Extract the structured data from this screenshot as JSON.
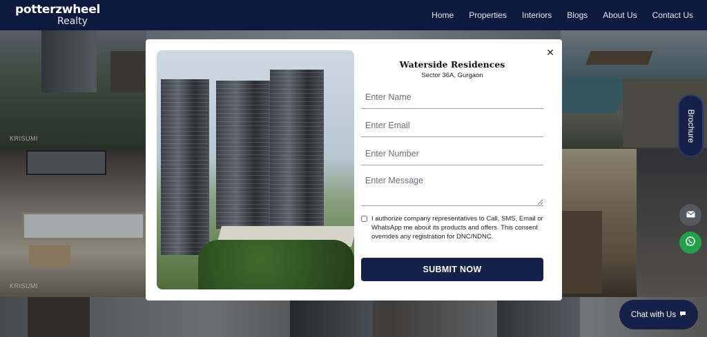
{
  "header": {
    "logo_line1": "potterzwheel",
    "logo_line2": "Realty",
    "nav": [
      "Home",
      "Properties",
      "Interiors",
      "Blogs",
      "About Us",
      "Contact Us"
    ]
  },
  "gallery": {
    "tags": [
      "KRISUMI",
      "KRISUMI"
    ]
  },
  "modal": {
    "title": "Waterside Residences",
    "subtitle": "Sector 36A, Gurgaon",
    "name_placeholder": "Enter Name",
    "email_placeholder": "Enter Email",
    "number_placeholder": "Enter Number",
    "message_placeholder": "Enter Message",
    "consent_text": "I authorize company representatives to Call, SMS, Email or WhatsApp me about its products and offers. This consent overrides any registration for DNC/NDNC.",
    "consent_checked": false,
    "submit_label": "SUBMIT NOW",
    "close_icon": "close-icon"
  },
  "floating": {
    "brochure_label": "Brochure",
    "chat_label": "Chat with Us",
    "icons": [
      "mail-icon",
      "whatsapp-icon",
      "chat-bubble-icon"
    ]
  },
  "colors": {
    "navy": "#16214a",
    "nav_bg": "#0e1a3d",
    "whatsapp": "#24a04a"
  }
}
